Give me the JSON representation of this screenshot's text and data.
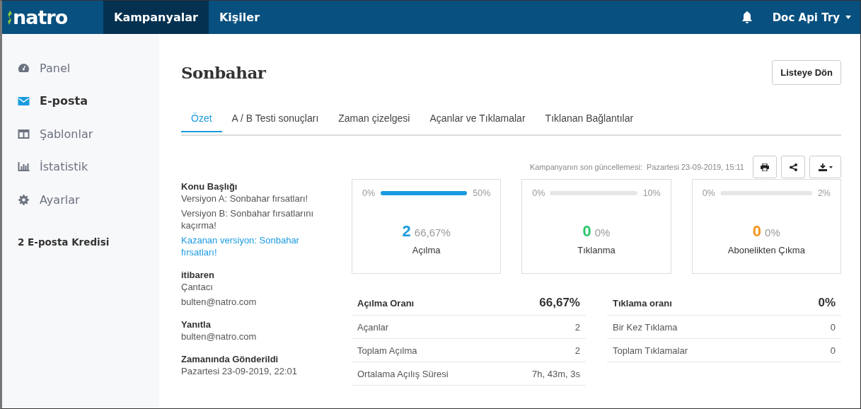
{
  "header": {
    "logo": "natro",
    "nav": [
      {
        "label": "Kampanyalar",
        "selected": true
      },
      {
        "label": "Kişiler",
        "selected": false
      }
    ],
    "user": "Doc Api Try"
  },
  "sidebar": {
    "items": [
      {
        "label": "Panel",
        "selected": false
      },
      {
        "label": "E-posta",
        "selected": true
      },
      {
        "label": "Şablonlar",
        "selected": false
      },
      {
        "label": "İstatistik",
        "selected": false
      },
      {
        "label": "Ayarlar",
        "selected": false
      }
    ],
    "credits": "2 E-posta Kredisi"
  },
  "title": "Sonbahar",
  "back_button": "Listeye Dön",
  "tabs": [
    {
      "label": "Özet",
      "selected": true
    },
    {
      "label": "A / B Testi sonuçları",
      "selected": false
    },
    {
      "label": "Zaman çizelgesi",
      "selected": false
    },
    {
      "label": "Açanlar ve Tıklamalar",
      "selected": false
    },
    {
      "label": "Tıklanan Bağlantılar",
      "selected": false
    }
  ],
  "last_update": {
    "label": "Kampanyanın son güncellemesi:",
    "value": "Pazartesi 23-09-2019, 15:11"
  },
  "info": [
    {
      "heading": "Konu Başlığı",
      "lines": [
        {
          "text": "Versiyon A: Sonbahar fırsatları!",
          "kind": "plain"
        },
        {
          "text": "Versiyon B: Sonbahar fırsatlarını kaçırma!",
          "kind": "plain"
        },
        {
          "text": "Kazanan versiyon: Sonbahar fırsatları!",
          "kind": "link"
        }
      ]
    },
    {
      "heading": "itibaren",
      "lines": [
        {
          "text": "Çantacı",
          "kind": "plain"
        },
        {
          "text": "bulten@natro.com",
          "kind": "plain"
        }
      ]
    },
    {
      "heading": "Yanıtla",
      "lines": [
        {
          "text": "bulten@natro.com",
          "kind": "plain"
        }
      ]
    },
    {
      "heading": "Zamanında Gönderildi",
      "lines": [
        {
          "text": "Pazartesi 23-09-2019, 22:01",
          "kind": "plain"
        }
      ]
    }
  ],
  "stats": [
    {
      "min": "0%",
      "max": "50%",
      "level": 1,
      "count": "2",
      "percent": "66,67%",
      "label": "Açılma",
      "color": "#1a9be0"
    },
    {
      "min": "0%",
      "max": "10%",
      "level": 0,
      "count": "0",
      "percent": "0%",
      "label": "Tıklanma",
      "color": "#2ec66e"
    },
    {
      "min": "0%",
      "max": "2%",
      "level": 0,
      "count": "0",
      "percent": "0%",
      "label": "Abonelikten Çıkma",
      "color": "#f7941d"
    }
  ],
  "tables": [
    {
      "title": "Açılma Oranı",
      "value": "66,67%",
      "rows": [
        {
          "label": "Açanlar",
          "value": "2"
        },
        {
          "label": "Toplam Açılma",
          "value": "2"
        },
        {
          "label": "Ortalama Açılış Süresi",
          "value": "7h, 43m, 3s"
        }
      ]
    },
    {
      "title": "Tıklama oranı",
      "value": "0%",
      "rows": [
        {
          "label": "Bir Kez Tıklama",
          "value": "0"
        },
        {
          "label": "Toplam Tıklamalar",
          "value": "0"
        }
      ]
    }
  ]
}
